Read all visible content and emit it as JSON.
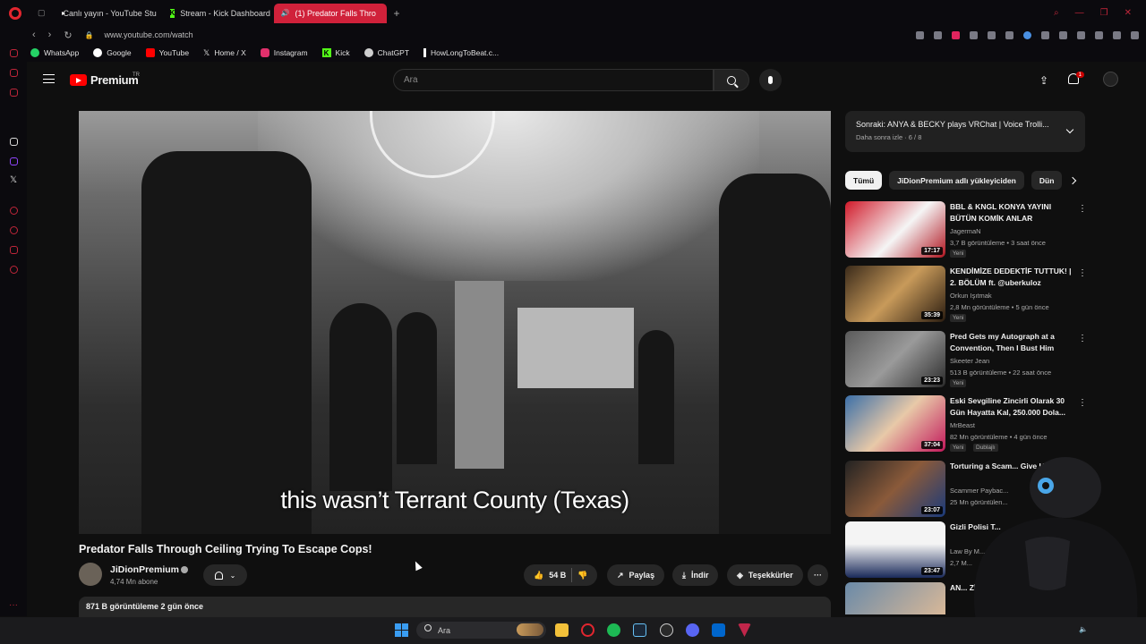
{
  "browser": {
    "tabs": [
      {
        "label": "Canlı yayın - YouTube Stu",
        "favicon": "youtube-icon"
      },
      {
        "label": "Stream - Kick Dashboard",
        "favicon": "kick-icon"
      },
      {
        "label": "(1) Predator Falls Thro",
        "favicon": "youtube-icon",
        "active": true
      }
    ],
    "url": "www.youtube.com/watch",
    "bookmarks": [
      {
        "label": "WhatsApp",
        "color": "#25d366"
      },
      {
        "label": "Google",
        "color": "#ffffff"
      },
      {
        "label": "YouTube",
        "color": "#ff0000"
      },
      {
        "label": "Home / X",
        "color": "#ffffff"
      },
      {
        "label": "Instagram",
        "color": "#e1306c"
      },
      {
        "label": "Kick",
        "color": "#53fc18"
      },
      {
        "label": "ChatGPT",
        "color": "#cfcfcf"
      },
      {
        "label": "HowLongToBeat.c...",
        "color": "#ffffff"
      }
    ],
    "accent": "#d0213a"
  },
  "youtube": {
    "brand": "Premium",
    "country_code": "TR",
    "search_placeholder": "Ara",
    "notification_count": "1"
  },
  "player": {
    "subtitle": "this wasn’t Terrant County (Texas)"
  },
  "video": {
    "title": "Predator Falls Through Ceiling Trying To Escape Cops!",
    "channel": "JiDionPremium",
    "subscribers": "4,74 Mn abone",
    "likes": "54 B",
    "share_label": "Paylaş",
    "download_label": "İndir",
    "thanks_label": "Teşekkürler",
    "description_meta": "871 B görüntüleme  2 gün önce"
  },
  "up_next": {
    "title": "Sonraki: ANYA & BECKY plays VRChat | Voice Trolli...",
    "subtitle": "Daha sonra izle · 6 / 8"
  },
  "chips": [
    "Tümü",
    "JiDionPremium adlı yükleyiciden",
    "Dün"
  ],
  "recommendations": [
    {
      "title": "BBL & KNGL KONYA YAYINI BÜTÜN KOMİK ANLAR",
      "channel": "JagermaN",
      "meta": "3,7 B görüntüleme • 3 saat önce",
      "badge": "Yeni",
      "duration": "17:17"
    },
    {
      "title": "KENDİMİZE DEDEKTİF TUTTUK! | 2. BÖLÜM ft. @uberkuloz",
      "channel": "Orkun Işıtmak",
      "meta": "2,8 Mn görüntüleme • 5 gün önce",
      "badge": "Yeni",
      "duration": "35:39"
    },
    {
      "title": "Pred Gets my Autograph at a Convention, Then I Bust Him",
      "channel": "Skeeter Jean",
      "meta": "513 B görüntüleme • 22 saat önce",
      "badge": "Yeni",
      "duration": "23:23"
    },
    {
      "title": "Eski Sevgiline Zincirli Olarak 30 Gün Hayatta Kal, 250.000 Dola...",
      "channel": "MrBeast",
      "meta": "82 Mn görüntüleme • 4 gün önce",
      "badge": "Yeni",
      "badge2": "Dublajlı",
      "duration": "37:04"
    },
    {
      "title": "Torturing a Scam... Give Up",
      "channel": "Scammer Paybac...",
      "meta": "25 Mn görüntülen...",
      "duration": "23:07"
    },
    {
      "title": "Gizli Polisi T...",
      "channel": "Law By M...",
      "meta": "2,7 M...",
      "duration": "23:47"
    },
    {
      "title": "AN... Zİ...",
      "channel": "",
      "meta": "",
      "duration": ""
    }
  ],
  "taskbar": {
    "search_label": "Ara"
  }
}
